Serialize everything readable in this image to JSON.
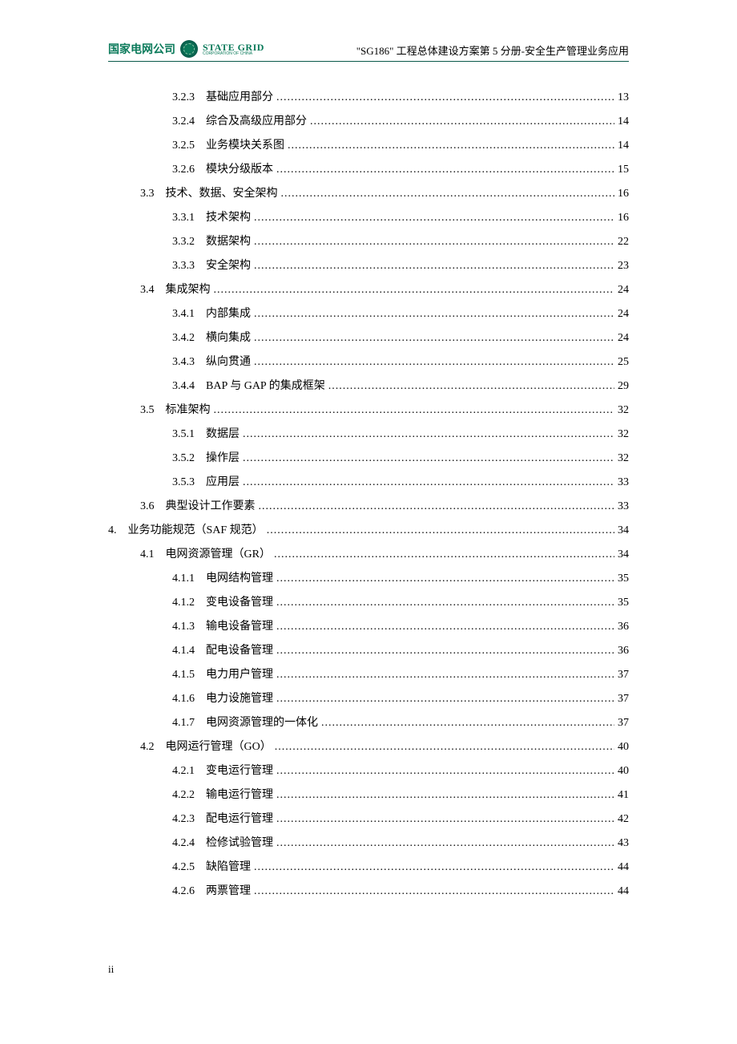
{
  "header": {
    "company_cn": "国家电网公司",
    "company_en_main": "STATE GRID",
    "company_en_sub": "CORPORATION OF CHINA",
    "doc_title": "\"SG186\" 工程总体建设方案第 5 分册-安全生产管理业务应用"
  },
  "toc": [
    {
      "level": 3,
      "num": "3.2.3",
      "title": "基础应用部分",
      "page": "13"
    },
    {
      "level": 3,
      "num": "3.2.4",
      "title": "综合及高级应用部分",
      "page": "14"
    },
    {
      "level": 3,
      "num": "3.2.5",
      "title": "业务模块关系图",
      "page": "14"
    },
    {
      "level": 3,
      "num": "3.2.6",
      "title": "模块分级版本",
      "page": "15"
    },
    {
      "level": 2,
      "num": "3.3",
      "title": "技术、数据、安全架构",
      "page": "16"
    },
    {
      "level": 3,
      "num": "3.3.1",
      "title": "技术架构",
      "page": "16"
    },
    {
      "level": 3,
      "num": "3.3.2",
      "title": "数据架构",
      "page": "22"
    },
    {
      "level": 3,
      "num": "3.3.3",
      "title": "安全架构",
      "page": "23"
    },
    {
      "level": 2,
      "num": "3.4",
      "title": "集成架构",
      "page": "24"
    },
    {
      "level": 3,
      "num": "3.4.1",
      "title": "内部集成",
      "page": "24"
    },
    {
      "level": 3,
      "num": "3.4.2",
      "title": "横向集成",
      "page": "24"
    },
    {
      "level": 3,
      "num": "3.4.3",
      "title": "纵向贯通",
      "page": "25"
    },
    {
      "level": 3,
      "num": "3.4.4",
      "title": "BAP 与 GAP 的集成框架",
      "page": "29"
    },
    {
      "level": 2,
      "num": "3.5",
      "title": "标准架构",
      "page": "32"
    },
    {
      "level": 3,
      "num": "3.5.1",
      "title": "数据层",
      "page": "32"
    },
    {
      "level": 3,
      "num": "3.5.2",
      "title": "操作层",
      "page": "32"
    },
    {
      "level": 3,
      "num": "3.5.3",
      "title": "应用层",
      "page": "33"
    },
    {
      "level": 2,
      "num": "3.6",
      "title": "典型设计工作要素",
      "page": "33"
    },
    {
      "level": 1,
      "num": "4.",
      "title": "业务功能规范（SAF 规范）",
      "page": "34"
    },
    {
      "level": 2,
      "num": "4.1",
      "title": "电网资源管理（GR）",
      "page": "34"
    },
    {
      "level": 3,
      "num": "4.1.1",
      "title": "电网结构管理",
      "page": "35"
    },
    {
      "level": 3,
      "num": "4.1.2",
      "title": "变电设备管理",
      "page": "35"
    },
    {
      "level": 3,
      "num": "4.1.3",
      "title": "输电设备管理",
      "page": "36"
    },
    {
      "level": 3,
      "num": "4.1.4",
      "title": "配电设备管理",
      "page": "36"
    },
    {
      "level": 3,
      "num": "4.1.5",
      "title": "电力用户管理",
      "page": "37"
    },
    {
      "level": 3,
      "num": "4.1.6",
      "title": "电力设施管理",
      "page": "37"
    },
    {
      "level": 3,
      "num": "4.1.7",
      "title": "电网资源管理的一体化",
      "page": "37"
    },
    {
      "level": 2,
      "num": "4.2",
      "title": "电网运行管理（GO）",
      "page": "40"
    },
    {
      "level": 3,
      "num": "4.2.1",
      "title": "变电运行管理",
      "page": "40"
    },
    {
      "level": 3,
      "num": "4.2.2",
      "title": "输电运行管理",
      "page": "41"
    },
    {
      "level": 3,
      "num": "4.2.3",
      "title": "配电运行管理",
      "page": "42"
    },
    {
      "level": 3,
      "num": "4.2.4",
      "title": "检修试验管理",
      "page": "43"
    },
    {
      "level": 3,
      "num": "4.2.5",
      "title": "缺陷管理",
      "page": "44"
    },
    {
      "level": 3,
      "num": "4.2.6",
      "title": "两票管理",
      "page": "44"
    }
  ],
  "page_number": "ii"
}
